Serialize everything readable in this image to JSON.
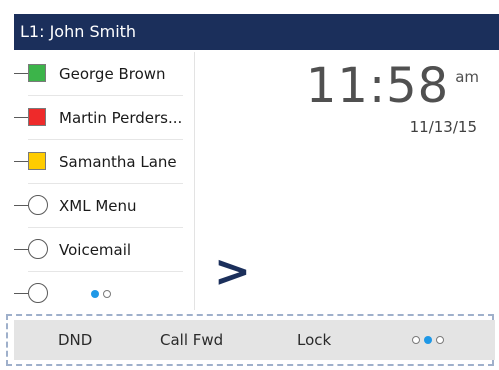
{
  "header": {
    "title": "L1: John Smith"
  },
  "lines": [
    {
      "label": "George Brown",
      "indicator": "square",
      "color": "#3cb44a"
    },
    {
      "label": "Martin Perders...",
      "indicator": "square",
      "color": "#ee2a2a"
    },
    {
      "label": "Samantha Lane",
      "indicator": "square",
      "color": "#ffcc00"
    },
    {
      "label": "XML Menu",
      "indicator": "circle"
    },
    {
      "label": "Voicemail",
      "indicator": "circle"
    },
    {
      "label": "",
      "indicator": "circle"
    }
  ],
  "sidebar_pagination": {
    "current": 1,
    "total": 2
  },
  "clock": {
    "time": "11:58",
    "ampm": "am",
    "date": "11/13/15"
  },
  "nav": {
    "arrow": ">"
  },
  "softkeys": {
    "dnd": "DND",
    "call_fwd": "Call Fwd",
    "lock": "Lock"
  },
  "softkey_pagination": {
    "current": 2,
    "total": 3
  },
  "colors": {
    "header_bg": "#1b2f5b",
    "accent_blue": "#1f98e6",
    "softkey_bg": "#e4e4e4"
  }
}
